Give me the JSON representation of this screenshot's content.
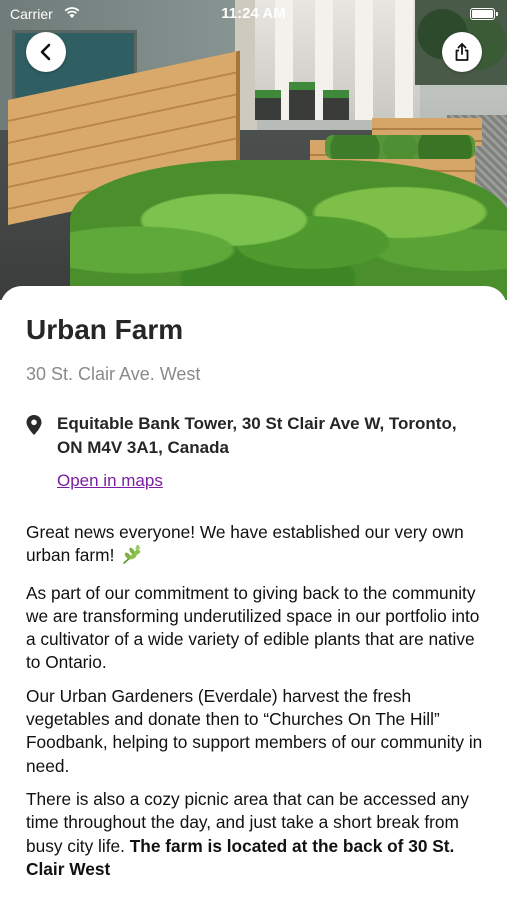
{
  "status_bar": {
    "carrier": "Carrier",
    "time": "11:24 AM"
  },
  "icons": {
    "back": "chevron-left-icon",
    "share": "share-icon",
    "location": "location-pin-icon",
    "wifi": "wifi-icon",
    "battery": "battery-icon",
    "leaf": "herb-leaf-icon"
  },
  "colors": {
    "link": "#7b1fa2",
    "title": "#262626",
    "subtitle": "#8a8a8a"
  },
  "detail": {
    "title": "Urban Farm",
    "subtitle": "30 St. Clair Ave. West",
    "address": "Equitable Bank Tower, 30 St Clair Ave W, Toronto, ON M4V 3A1, Canada",
    "maps_link": "Open in maps"
  },
  "description": {
    "p1": "Great news everyone! We have established our very own urban farm!",
    "p2": "As part of our commitment to giving back to the community we are transforming underutilized space in our portfolio into a cultivator of a wide variety of edible plants that are native to Ontario.",
    "p3": "Our Urban Gardeners (Everdale) harvest the fresh vegetables and donate then to “Churches On The Hill” Foodbank, helping to support members of our community in need.",
    "p4_text": "There is also a cozy picnic area that can be accessed any time throughout the day, and just take a short break from busy city life. ",
    "p4_bold": "The farm is located at the back of 30 St. Clair West"
  }
}
